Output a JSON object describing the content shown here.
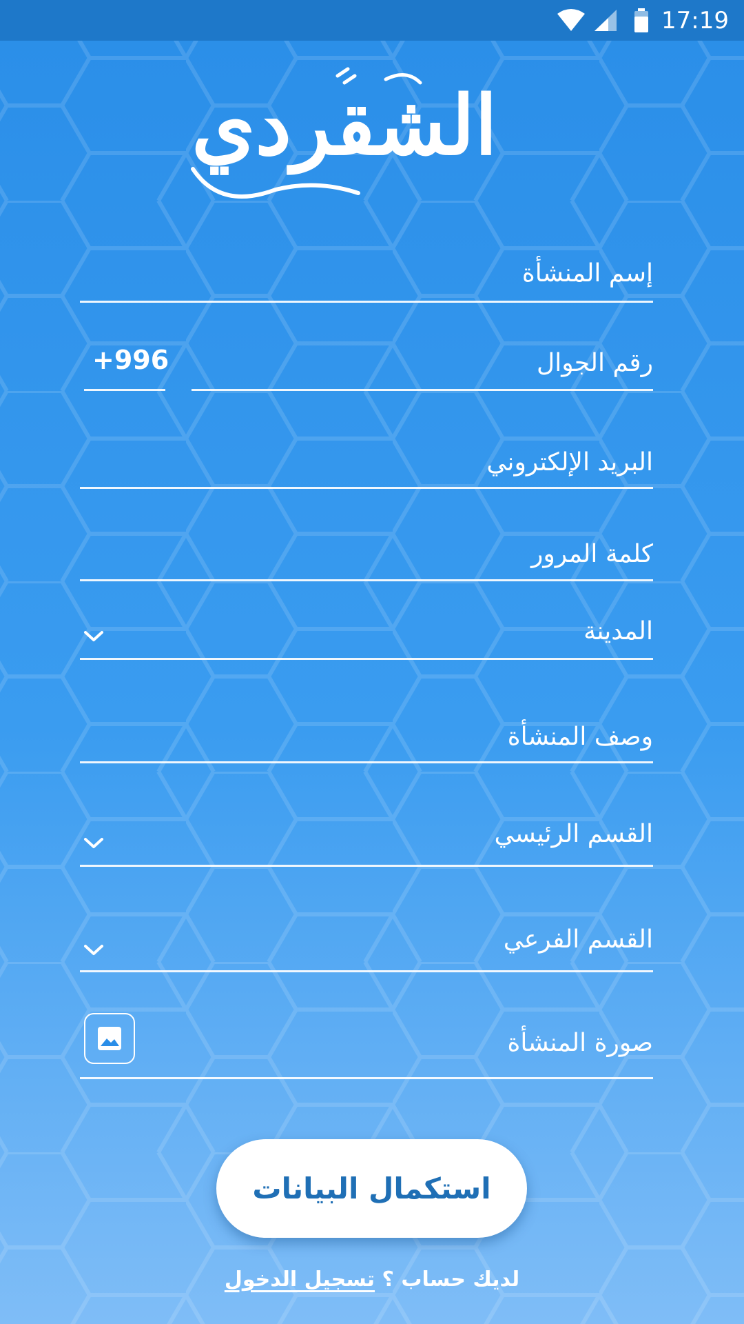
{
  "status_bar": {
    "time": "17:19",
    "icons": [
      "wifi-icon",
      "signal-icon",
      "battery-icon"
    ]
  },
  "logo": {
    "text": "الشقردي"
  },
  "form": {
    "fields": [
      {
        "label": "إسم المنشأة",
        "type": "text"
      },
      {
        "label": "رقم الجوال",
        "type": "phone",
        "country_code": "+996"
      },
      {
        "label": "البريد الإلكتروني",
        "type": "email"
      },
      {
        "label": "كلمة المرور",
        "type": "password"
      },
      {
        "label": "المدينة",
        "type": "dropdown",
        "icon": "chevron-down-icon"
      },
      {
        "label": "وصف المنشأة",
        "type": "text"
      },
      {
        "label": "القسم الرئيسي",
        "type": "dropdown",
        "icon": "chevron-down-icon"
      },
      {
        "label": "القسم الفرعي",
        "type": "dropdown",
        "icon": "chevron-down-icon"
      },
      {
        "label": "صورة  المنشأة",
        "type": "image",
        "icon": "image-icon"
      }
    ],
    "submit_label": "استكمال البيانات"
  },
  "footer": {
    "prompt": "لديك حساب ؟",
    "login_link": "تسجيل الدخول"
  },
  "colors": {
    "background_top": "#2a8ee8",
    "background_bottom": "#7fbdf7",
    "status_bar": "#1e78c9",
    "button_text": "#1f6fb5"
  }
}
